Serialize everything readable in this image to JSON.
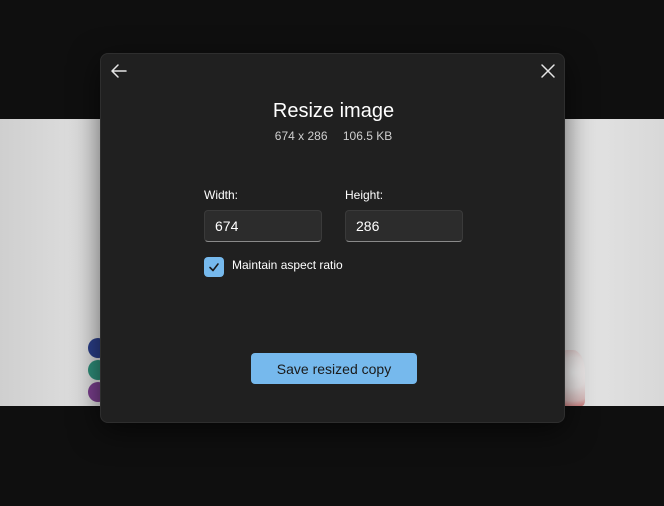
{
  "dialog": {
    "title": "Resize image",
    "dimensions": "674 x 286",
    "file_size": "106.5 KB",
    "back_icon": "arrow-left-icon",
    "close_icon": "close-icon"
  },
  "form": {
    "width_label": "Width:",
    "width_value": "674",
    "height_label": "Height:",
    "height_value": "286",
    "maintain_aspect_label": "Maintain aspect ratio",
    "maintain_aspect_checked": true
  },
  "actions": {
    "save_label": "Save resized copy"
  },
  "colors": {
    "accent": "#76b9ed",
    "dialog_bg": "#202020",
    "page_bg": "#0f0f0f"
  }
}
